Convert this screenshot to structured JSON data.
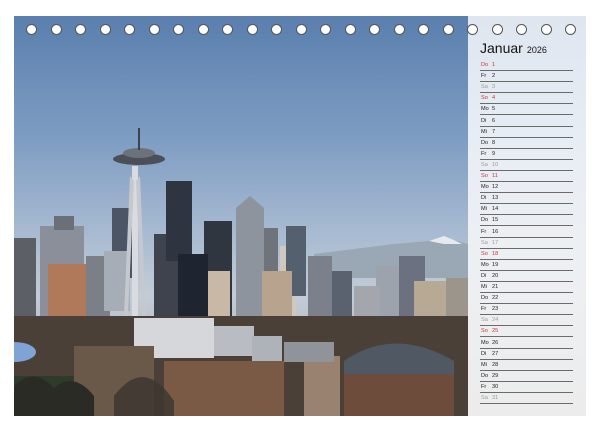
{
  "calendar": {
    "month": "Januar",
    "year": "2026",
    "days": [
      {
        "weekday": "Do",
        "day": "1",
        "type": "holiday"
      },
      {
        "weekday": "Fr",
        "day": "2",
        "type": "weekday"
      },
      {
        "weekday": "Sa",
        "day": "3",
        "type": "sat"
      },
      {
        "weekday": "So",
        "day": "4",
        "type": "sun"
      },
      {
        "weekday": "Mo",
        "day": "5",
        "type": "weekday"
      },
      {
        "weekday": "Di",
        "day": "6",
        "type": "weekday"
      },
      {
        "weekday": "Mi",
        "day": "7",
        "type": "weekday"
      },
      {
        "weekday": "Do",
        "day": "8",
        "type": "weekday"
      },
      {
        "weekday": "Fr",
        "day": "9",
        "type": "weekday"
      },
      {
        "weekday": "Sa",
        "day": "10",
        "type": "sat"
      },
      {
        "weekday": "So",
        "day": "11",
        "type": "sun"
      },
      {
        "weekday": "Mo",
        "day": "12",
        "type": "weekday"
      },
      {
        "weekday": "Di",
        "day": "13",
        "type": "weekday"
      },
      {
        "weekday": "Mi",
        "day": "14",
        "type": "weekday"
      },
      {
        "weekday": "Do",
        "day": "15",
        "type": "weekday"
      },
      {
        "weekday": "Fr",
        "day": "16",
        "type": "weekday"
      },
      {
        "weekday": "Sa",
        "day": "17",
        "type": "sat"
      },
      {
        "weekday": "So",
        "day": "18",
        "type": "sun"
      },
      {
        "weekday": "Mo",
        "day": "19",
        "type": "weekday"
      },
      {
        "weekday": "Di",
        "day": "20",
        "type": "weekday"
      },
      {
        "weekday": "Mi",
        "day": "21",
        "type": "weekday"
      },
      {
        "weekday": "Do",
        "day": "22",
        "type": "weekday"
      },
      {
        "weekday": "Fr",
        "day": "23",
        "type": "weekday"
      },
      {
        "weekday": "Sa",
        "day": "24",
        "type": "sat"
      },
      {
        "weekday": "So",
        "day": "25",
        "type": "sun"
      },
      {
        "weekday": "Mo",
        "day": "26",
        "type": "weekday"
      },
      {
        "weekday": "Di",
        "day": "27",
        "type": "weekday"
      },
      {
        "weekday": "Mi",
        "day": "28",
        "type": "weekday"
      },
      {
        "weekday": "Do",
        "day": "29",
        "type": "weekday"
      },
      {
        "weekday": "Fr",
        "day": "30",
        "type": "weekday"
      },
      {
        "weekday": "Sa",
        "day": "31",
        "type": "sat"
      }
    ]
  },
  "binding_rings": 23,
  "colors": {
    "sunday_holiday": "#c83232",
    "saturday": "#9a9a9a",
    "weekday": "#222222",
    "sky": "#6a8dbb"
  }
}
